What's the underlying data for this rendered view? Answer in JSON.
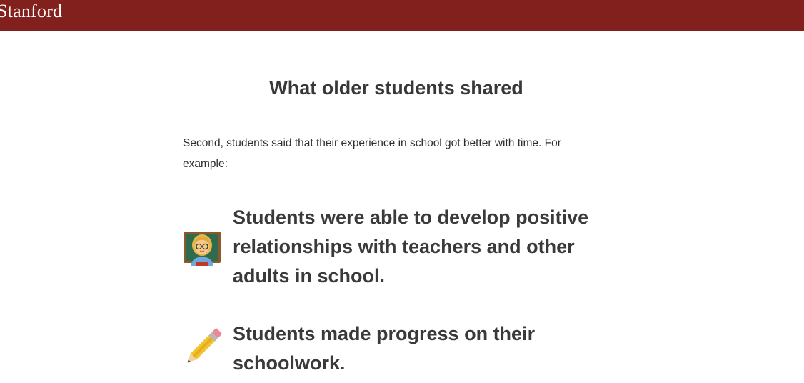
{
  "header": {
    "logo_text": "Stanford",
    "brand_color": "#82201d"
  },
  "main": {
    "title": "What older students shared",
    "intro": "Second, students said that their experience in school got better with time. For example:",
    "points": [
      {
        "icon": "teacher-icon",
        "text": "Students were able to develop positive relationships with teachers and other adults in school."
      },
      {
        "icon": "pencil-icon",
        "text": "Students made progress on their schoolwork."
      }
    ]
  }
}
